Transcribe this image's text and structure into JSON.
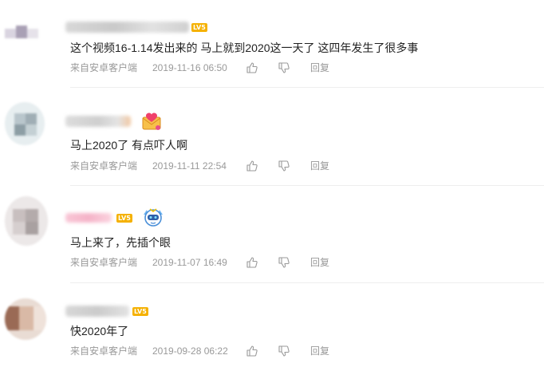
{
  "comments": [
    {
      "badge": "LV5",
      "text": "这个视频16-1.14发出来的 马上就到2020这一天了 这四年发生了很多事",
      "source": "来自安卓客户端",
      "time": "2019-11-16 06:50",
      "reply": "回复"
    },
    {
      "badge": "",
      "text": "马上2020了 有点吓人啊",
      "source": "来自安卓客户端",
      "time": "2019-11-11 22:54",
      "reply": "回复"
    },
    {
      "badge": "LV5",
      "text": "马上来了，先插个眼",
      "source": "来自安卓客户端",
      "time": "2019-11-07 16:49",
      "reply": "回复"
    },
    {
      "badge": "LV5",
      "text": "快2020年了",
      "source": "来自安卓客户端",
      "time": "2019-09-28 06:22",
      "reply": "回复"
    }
  ],
  "icons": {
    "like": "thumbs-up-icon",
    "dislike": "thumbs-down-icon",
    "medal_2": "heart-envelope-icon",
    "medal_3": "robot-mascot-icon"
  },
  "colors": {
    "badge": "#f5b100",
    "meta_text": "#999999",
    "divider": "#eeeeee"
  }
}
